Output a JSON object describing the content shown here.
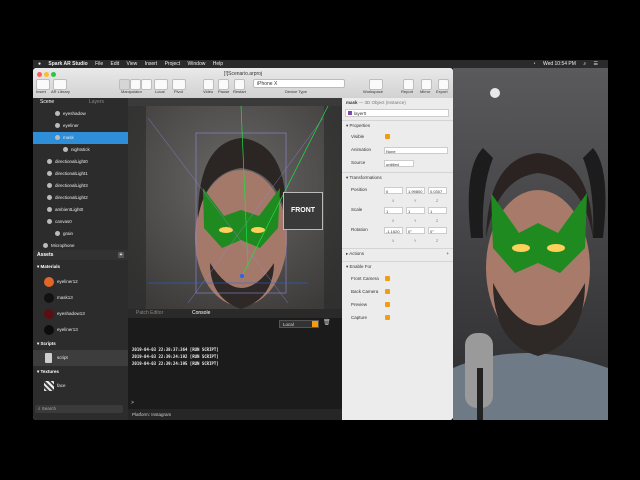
{
  "menubar": {
    "app_name": "Spark AR Studio",
    "items": [
      "File",
      "Edit",
      "View",
      "Insert",
      "Project",
      "Window",
      "Help"
    ],
    "clock": "Wed 10:54 PM"
  },
  "window": {
    "document_title": "[!]Scenario.arproj",
    "toolbar": {
      "insert": "Insert",
      "ar_library": "AR Library",
      "manipulator": "Manipulator",
      "local": "Local",
      "pivot": "Pivot",
      "video": "Video",
      "pause": "Pause",
      "restart": "Restart",
      "device": "iPhone X",
      "device_type": "Device Type",
      "workspace": "Workspace",
      "report": "Report",
      "mirror": "Mirror",
      "export": "Export"
    }
  },
  "scene": {
    "tab_scene": "Scene",
    "tab_layers": "Layers",
    "rows": [
      {
        "label": "eyeshadow",
        "indent": 1
      },
      {
        "label": "eyeliner",
        "indent": 1
      },
      {
        "label": "mask",
        "indent": 1,
        "selected": true
      },
      {
        "label": "nightstick",
        "indent": 2
      },
      {
        "label": "directionalLight0",
        "indent": 0
      },
      {
        "label": "directionalLight1",
        "indent": 0
      },
      {
        "label": "directionalLight3",
        "indent": 0
      },
      {
        "label": "directionalLight2",
        "indent": 0
      },
      {
        "label": "ambientLight0",
        "indent": 0
      },
      {
        "label": "canvas0",
        "indent": 0
      },
      {
        "label": "grain",
        "indent": 1
      },
      {
        "label": "Microphone",
        "indent": -1
      }
    ]
  },
  "assets": {
    "title": "Assets",
    "materials_label": "Materials",
    "materials": [
      {
        "name": "eyeliner12",
        "color": "#e0662a"
      },
      {
        "name": "mask13",
        "color": "#111111"
      },
      {
        "name": "eyeshadow13",
        "color": "#5a0f14"
      },
      {
        "name": "eyeliner13",
        "color": "#0c0c0c"
      }
    ],
    "scripts_label": "Scripts",
    "scripts": [
      "script"
    ],
    "textures_label": "Textures",
    "textures": [
      "face"
    ],
    "search_placeholder": "Search"
  },
  "viewport": {
    "front_label": "FRONT"
  },
  "console": {
    "tab_patch": "Patch Editor",
    "tab_console": "Console",
    "scope": "Local",
    "lines": [
      "2019-04-03 22:38:37:364 [RUN SCRIPT]",
      "2019-04-03 22:39:24:192 [RUN SCRIPT]",
      "2019-04-03 22:39:24:195 [RUN SCRIPT]"
    ],
    "prompt": ">",
    "platform": "Platform: Instagram"
  },
  "inspector": {
    "object_name": "mask",
    "object_type": "— 3D Object (Instance)",
    "layer": "layer0",
    "properties_label": "Properties",
    "visible_label": "Visible",
    "animation_label": "Animation",
    "animation_value": "None",
    "source_label": "Source",
    "source_value": "untitled",
    "transformations_label": "Transformations",
    "position_label": "Position",
    "position": [
      "0",
      "1.99800",
      "0.0307"
    ],
    "scale_label": "Scale",
    "scale": [
      "1",
      "1",
      "1"
    ],
    "rotation_label": "Rotation",
    "rotation": [
      "-1.1620",
      "0°",
      "0°"
    ],
    "axes": [
      "X",
      "Y",
      "Z"
    ],
    "actions_label": "Actions",
    "enable_for_label": "Enable For",
    "enable_for": [
      "Front Camera",
      "Back Camera",
      "Preview",
      "Capture"
    ]
  },
  "colors": {
    "accent_orange": "#f39c12",
    "selection_blue": "#2e8ed8",
    "mask_green": "#1f8a1f"
  }
}
